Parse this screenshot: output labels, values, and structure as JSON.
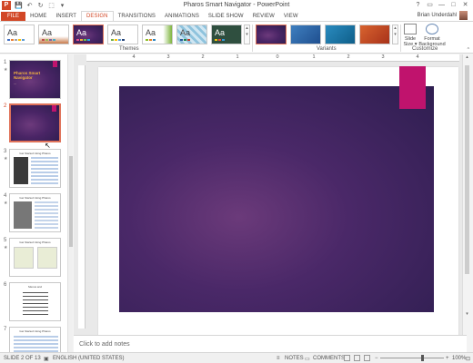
{
  "window": {
    "title": "Pharos Smart Navigator - PowerPoint",
    "app_icon_letter": "P",
    "controls": [
      "?",
      "▭",
      "—",
      "□",
      "✕"
    ]
  },
  "qat": {
    "save": "💾",
    "undo": "↶",
    "redo": "↻",
    "start": "⬚",
    "more": "▾"
  },
  "tabs": [
    "FILE",
    "HOME",
    "INSERT",
    "DESIGN",
    "TRANSITIONS",
    "ANIMATIONS",
    "SLIDE SHOW",
    "REVIEW",
    "VIEW"
  ],
  "active_tab": "DESIGN",
  "user": {
    "name": "Brian Underdahl"
  },
  "ribbon": {
    "themes_label": "Themes",
    "variants_label": "Variants",
    "customize_label": "Customize",
    "theme_aa": "Aa",
    "slide_size": "Slide\nSize ▾",
    "slide_size_line1": "Slide",
    "slide_size_line2": "Size ▾",
    "format_bg_line1": "Format",
    "format_bg_line2": "Background",
    "scroll_up": "▴",
    "scroll_down": "▾",
    "collapse": "^"
  },
  "slides": [
    {
      "num": "1",
      "title": "Pharos Smart Navigator",
      "subtitle": "—"
    },
    {
      "num": "2"
    },
    {
      "num": "3",
      "heading": "Get Started Using Pharos"
    },
    {
      "num": "4",
      "heading": "Get Started Using Pharos"
    },
    {
      "num": "5",
      "heading": "Get Started Using Pharos"
    },
    {
      "num": "6",
      "heading": "Menus and"
    },
    {
      "num": "7",
      "heading": "Get Started Using Pharos"
    }
  ],
  "ruler": {
    "h_labels": [
      "4",
      "3",
      "2",
      "1",
      "0",
      "1",
      "2",
      "3",
      "4"
    ]
  },
  "notes": {
    "placeholder": "Click to add notes"
  },
  "status": {
    "slide_counter": "SLIDE 2 OF 13",
    "language": "ENGLISH (UNITED STATES)",
    "notes": "NOTES",
    "comments": "COMMENTS",
    "zoom": "100%",
    "zoom_minus": "−",
    "zoom_plus": "+"
  },
  "colors": {
    "accent": "#d24726",
    "slide_purple_dark": "#2e1e50",
    "slide_purple_light": "#6b3a7a",
    "tag_magenta": "#c0136d"
  }
}
